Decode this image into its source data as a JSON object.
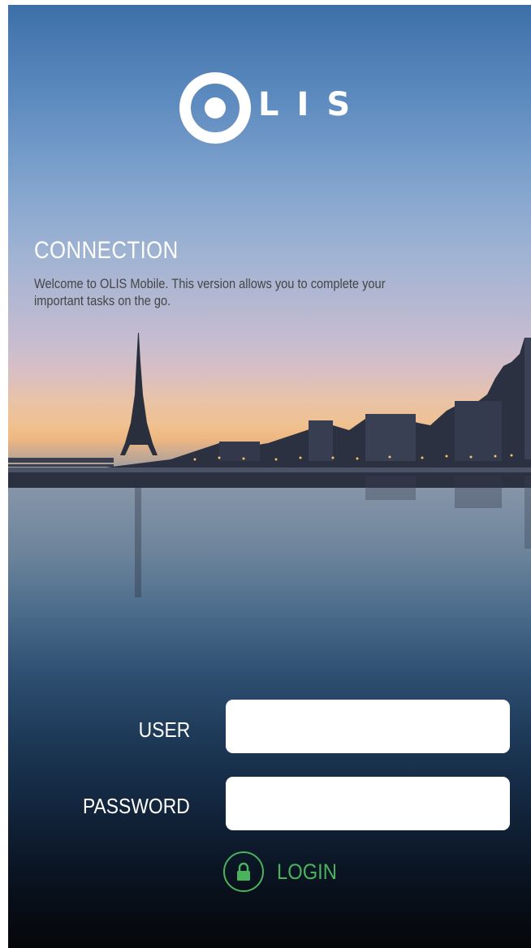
{
  "logo": {
    "text": "LIS",
    "icon": "olis-ring-logo"
  },
  "connection": {
    "title": "CONNECTION",
    "welcome_line1": "Welcome to OLIS Mobile. This version allows you to complete your",
    "welcome_line2": "important tasks on the go."
  },
  "form": {
    "user_label": "USER",
    "user_value": "",
    "password_label": "PASSWORD",
    "password_value": "",
    "login_label": "LOGIN",
    "login_icon": "lock-icon"
  },
  "colors": {
    "accent": "#4bb35c",
    "text": "#ffffff"
  }
}
